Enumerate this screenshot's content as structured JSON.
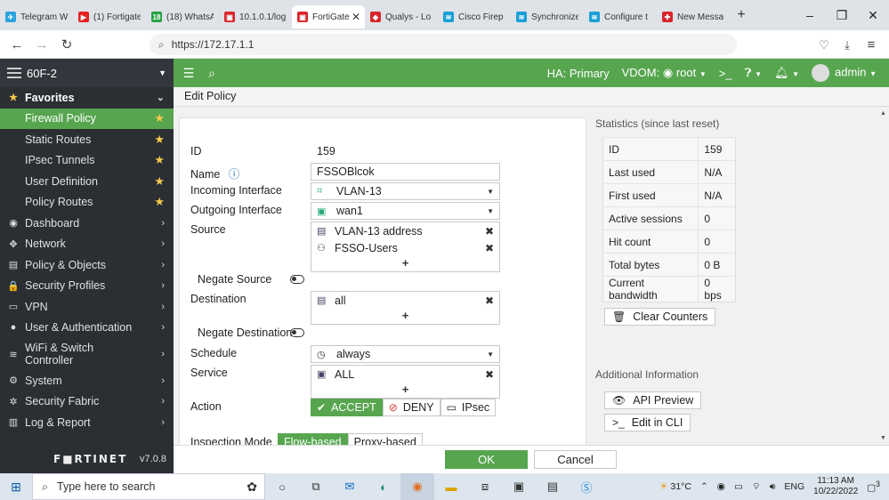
{
  "browser": {
    "tabs": [
      {
        "title": "Telegram W",
        "color": "#2aa3df",
        "glyph": "✈"
      },
      {
        "title": "(1) Fortigate",
        "color": "#e32222",
        "glyph": "▶"
      },
      {
        "title": "(18) WhatsA",
        "color": "#25a244",
        "glyph": "18"
      },
      {
        "title": "10.1.0.1/log",
        "color": "#d9262a",
        "glyph": "▣"
      },
      {
        "title": "FortiGate",
        "color": "#d9262a",
        "glyph": "▣",
        "active": true
      },
      {
        "title": "Qualys - Lo",
        "color": "#d9262a",
        "glyph": "◆"
      },
      {
        "title": "Cisco Firep",
        "color": "#1ba0d7",
        "glyph": "≋"
      },
      {
        "title": "Synchronize",
        "color": "#1ba0d7",
        "glyph": "≋"
      },
      {
        "title": "Configure t",
        "color": "#1ba0d7",
        "glyph": "≋"
      },
      {
        "title": "New Messa",
        "color": "#d9262a",
        "glyph": "✚"
      }
    ],
    "url": "https://172.17.1.1"
  },
  "sidebar": {
    "device": "60F-2",
    "favorites_label": "Favorites",
    "favorites": [
      {
        "label": "Firewall Policy",
        "active": true
      },
      {
        "label": "Static Routes"
      },
      {
        "label": "IPsec Tunnels"
      },
      {
        "label": "User Definition"
      },
      {
        "label": "Policy Routes"
      }
    ],
    "menu": [
      {
        "label": "Dashboard",
        "icon": "◉"
      },
      {
        "label": "Network",
        "icon": "✥"
      },
      {
        "label": "Policy & Objects",
        "icon": "▤"
      },
      {
        "label": "Security Profiles",
        "icon": "🔒"
      },
      {
        "label": "VPN",
        "icon": "▭"
      },
      {
        "label": "User & Authentication",
        "icon": "●"
      },
      {
        "label": "WiFi & Switch Controller",
        "icon": "≋",
        "tall": true
      },
      {
        "label": "System",
        "icon": "⚙"
      },
      {
        "label": "Security Fabric",
        "icon": "✲"
      },
      {
        "label": "Log & Report",
        "icon": "▥"
      }
    ],
    "brand": "F■RTINET",
    "version": "v7.0.8"
  },
  "topbar": {
    "ha": "HA: Primary",
    "vdom_label": "VDOM:",
    "vdom": "root",
    "admin": "admin"
  },
  "page_title": "Edit Policy",
  "form": {
    "id_label": "ID",
    "id_value": "159",
    "name_label": "Name",
    "name_value": "FSSOBlcok",
    "incoming_label": "Incoming Interface",
    "incoming_value": "VLAN-13",
    "outgoing_label": "Outgoing Interface",
    "outgoing_value": "wan1",
    "source_label": "Source",
    "source_items": [
      "VLAN-13 address",
      "FSSO-Users"
    ],
    "negate_source_label": "Negate Source",
    "destination_label": "Destination",
    "destination_items": [
      "all"
    ],
    "negate_destination_label": "Negate Destination",
    "schedule_label": "Schedule",
    "schedule_value": "always",
    "service_label": "Service",
    "service_items": [
      "ALL"
    ],
    "action_label": "Action",
    "action_options": [
      "ACCEPT",
      "DENY",
      "IPsec"
    ],
    "action_selected": "ACCEPT",
    "inspection_label": "Inspection Mode",
    "inspection_options": [
      "Flow-based",
      "Proxy-based"
    ],
    "inspection_selected": "Flow-based"
  },
  "stats": {
    "title": "Statistics (since last reset)",
    "rows": [
      {
        "k": "ID",
        "v": "159"
      },
      {
        "k": "Last used",
        "v": "N/A"
      },
      {
        "k": "First used",
        "v": "N/A"
      },
      {
        "k": "Active sessions",
        "v": "0"
      },
      {
        "k": "Hit count",
        "v": "0"
      },
      {
        "k": "Total bytes",
        "v": "0 B"
      },
      {
        "k": "Current bandwidth",
        "v": "0 bps"
      }
    ],
    "clear_label": "Clear Counters",
    "additional_title": "Additional Information",
    "api_preview_label": "API Preview",
    "edit_cli_label": "Edit in CLI"
  },
  "footer": {
    "ok": "OK",
    "cancel": "Cancel"
  },
  "taskbar": {
    "search_placeholder": "Type here to search",
    "weather": "31°C",
    "lang": "ENG",
    "time": "11:13 AM",
    "date": "10/22/2022",
    "notifications": "3"
  }
}
